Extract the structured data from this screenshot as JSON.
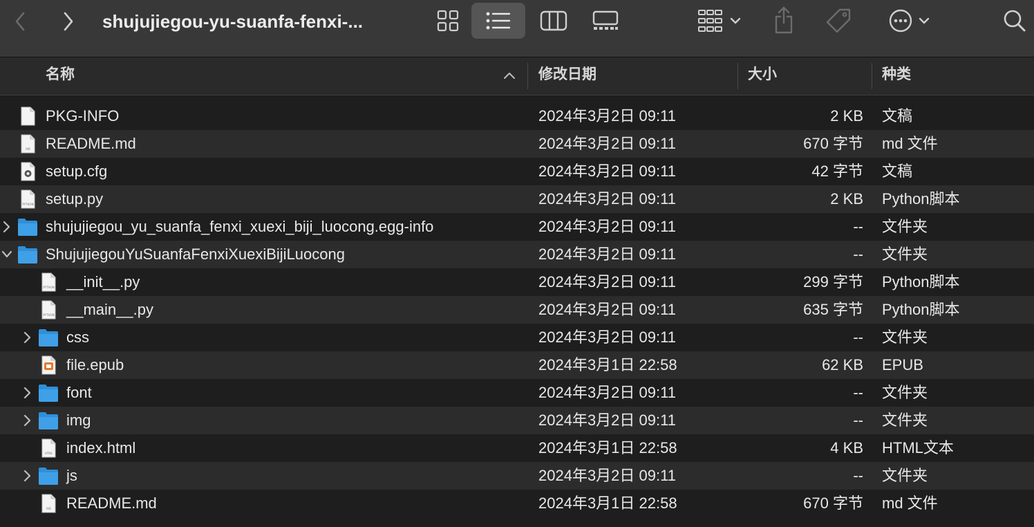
{
  "toolbar": {
    "title": "shujujiegou-yu-suanfa-fenxi-..."
  },
  "columns": {
    "name": "名称",
    "date": "修改日期",
    "size": "大小",
    "kind": "种类"
  },
  "files": [
    {
      "name": "PKG-INFO",
      "date": "2024年3月2日 09:11",
      "size": "2 KB",
      "kind": "文稿",
      "icon": "document-icon",
      "depth": 0,
      "disclosure": "none"
    },
    {
      "name": "README.md",
      "date": "2024年3月2日 09:11",
      "size": "670 字节",
      "kind": "md 文件",
      "icon": "markdown-file-icon",
      "depth": 0,
      "disclosure": "none"
    },
    {
      "name": "setup.cfg",
      "date": "2024年3月2日 09:11",
      "size": "42 字节",
      "kind": "文稿",
      "icon": "config-file-icon",
      "depth": 0,
      "disclosure": "none"
    },
    {
      "name": "setup.py",
      "date": "2024年3月2日 09:11",
      "size": "2 KB",
      "kind": "Python脚本",
      "icon": "python-file-icon",
      "depth": 0,
      "disclosure": "none"
    },
    {
      "name": "shujujiegou_yu_suanfa_fenxi_xuexi_biji_luocong.egg-info",
      "date": "2024年3月2日 09:11",
      "size": "--",
      "kind": "文件夹",
      "icon": "folder-icon",
      "depth": 0,
      "disclosure": "collapsed"
    },
    {
      "name": "ShujujiegouYuSuanfaFenxiXuexiBijiLuocong",
      "date": "2024年3月2日 09:11",
      "size": "--",
      "kind": "文件夹",
      "icon": "folder-icon",
      "depth": 0,
      "disclosure": "expanded"
    },
    {
      "name": "__init__.py",
      "date": "2024年3月2日 09:11",
      "size": "299 字节",
      "kind": "Python脚本",
      "icon": "python-file-icon",
      "depth": 1,
      "disclosure": "none"
    },
    {
      "name": "__main__.py",
      "date": "2024年3月2日 09:11",
      "size": "635 字节",
      "kind": "Python脚本",
      "icon": "python-file-icon",
      "depth": 1,
      "disclosure": "none"
    },
    {
      "name": "css",
      "date": "2024年3月2日 09:11",
      "size": "--",
      "kind": "文件夹",
      "icon": "folder-icon",
      "depth": 1,
      "disclosure": "collapsed"
    },
    {
      "name": "file.epub",
      "date": "2024年3月1日 22:58",
      "size": "62 KB",
      "kind": "EPUB",
      "icon": "epub-file-icon",
      "depth": 1,
      "disclosure": "none"
    },
    {
      "name": "font",
      "date": "2024年3月2日 09:11",
      "size": "--",
      "kind": "文件夹",
      "icon": "folder-icon",
      "depth": 1,
      "disclosure": "collapsed"
    },
    {
      "name": "img",
      "date": "2024年3月2日 09:11",
      "size": "--",
      "kind": "文件夹",
      "icon": "folder-icon",
      "depth": 1,
      "disclosure": "collapsed"
    },
    {
      "name": "index.html",
      "date": "2024年3月1日 22:58",
      "size": "4 KB",
      "kind": "HTML文本",
      "icon": "html-file-icon",
      "depth": 1,
      "disclosure": "none"
    },
    {
      "name": "js",
      "date": "2024年3月2日 09:11",
      "size": "--",
      "kind": "文件夹",
      "icon": "folder-icon",
      "depth": 1,
      "disclosure": "collapsed"
    },
    {
      "name": "README.md",
      "date": "2024年3月1日 22:58",
      "size": "670 字节",
      "kind": "md 文件",
      "icon": "markdown-file-icon",
      "depth": 1,
      "disclosure": "none"
    }
  ],
  "colors": {
    "toolbar_bg": "#383838",
    "window_bg": "#1e1e1e",
    "row_alt_bg": "#2c2c2c",
    "folder_blue": "#3fa0e8",
    "epub_orange": "#e8782a"
  }
}
